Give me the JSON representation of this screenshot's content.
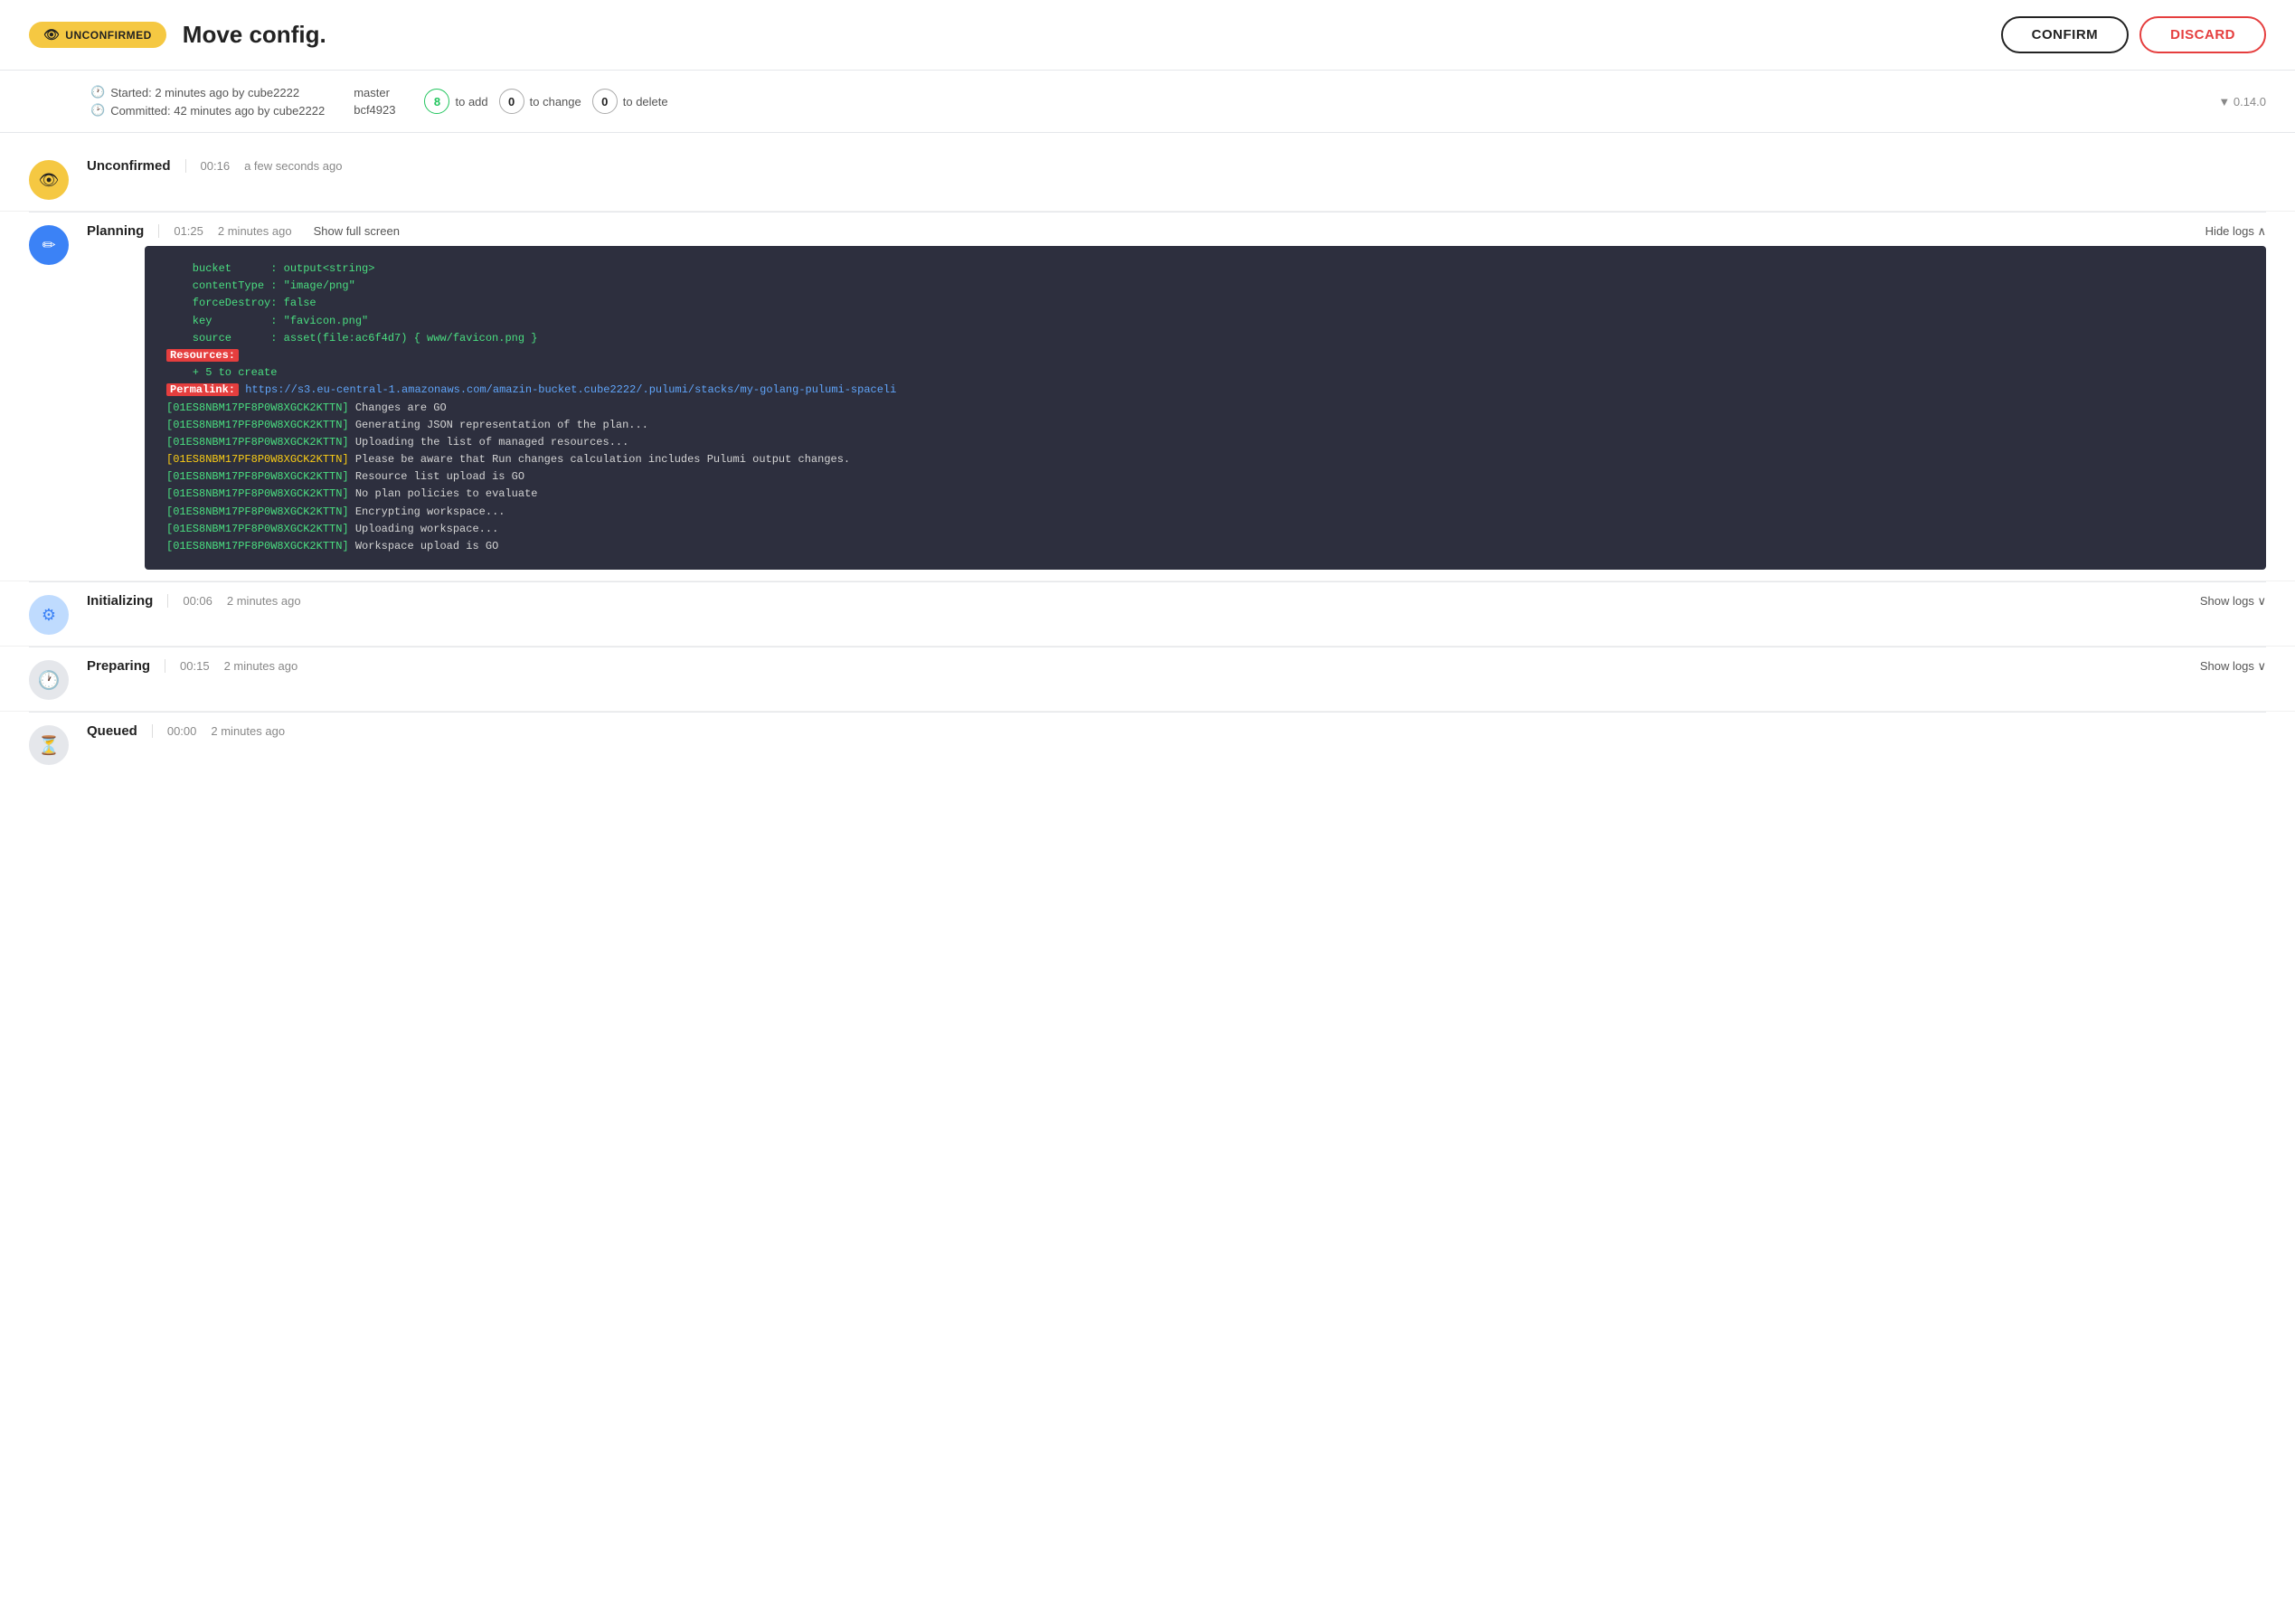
{
  "header": {
    "badge_label": "UNCONFIRMED",
    "title": "Move config.",
    "confirm_label": "CONFIRM",
    "discard_label": "DISCARD"
  },
  "meta": {
    "started": "Started: 2 minutes ago by cube2222",
    "committed": "Committed: 42 minutes ago by cube2222",
    "branch": "master",
    "commit": "bcf4923",
    "add_count": "8",
    "add_label": "to add",
    "change_count": "0",
    "change_label": "to change",
    "delete_count": "0",
    "delete_label": "to delete",
    "version": "▼ 0.14.0"
  },
  "steps": [
    {
      "icon_type": "yellow",
      "icon": "👁",
      "name": "Unconfirmed",
      "duration": "00:16",
      "time": "a few seconds ago",
      "show_logs_label": null
    },
    {
      "icon_type": "blue",
      "icon": "✏",
      "name": "Planning",
      "duration": "01:25",
      "time": "2 minutes ago",
      "show_full_screen": "Show full screen",
      "show_logs_label": "Hide logs ∧",
      "has_logs": true
    },
    {
      "icon_type": "blue-light",
      "icon": "⚙",
      "name": "Initializing",
      "duration": "00:06",
      "time": "2 minutes ago",
      "show_logs_label": "Show logs ∨"
    },
    {
      "icon_type": "gray",
      "icon": "🕐",
      "name": "Preparing",
      "duration": "00:15",
      "time": "2 minutes ago",
      "show_logs_label": "Show logs ∨"
    },
    {
      "icon_type": "gray",
      "icon": "⏳",
      "name": "Queued",
      "duration": "00:00",
      "time": "2 minutes ago",
      "show_logs_label": null
    }
  ],
  "logs": {
    "lines": [
      {
        "type": "green",
        "text": "    bucket      : output<string>"
      },
      {
        "type": "green",
        "text": "    contentType : \"image/png\""
      },
      {
        "type": "green",
        "text": "    forceDestroy: false"
      },
      {
        "type": "green",
        "text": "    key         : \"favicon.png\""
      },
      {
        "type": "green",
        "text": "    source      : asset(file:ac6f4d7) { www/favicon.png }"
      },
      {
        "type": "red-bg-label",
        "label": "Resources:",
        "text": ""
      },
      {
        "type": "green",
        "text": "    + 5 to create"
      },
      {
        "type": "permalink",
        "label": "Permalink:",
        "url": "https://s3.eu-central-1.amazonaws.com/amazin-bucket.cube2222/.pulumi/stacks/my-golang-pulumi-spaceli"
      },
      {
        "type": "cyan",
        "id": "[01ES8NBM17PF8P0W8XGCK2KTTN]",
        "text": " Changes are GO"
      },
      {
        "type": "cyan",
        "id": "[01ES8NBM17PF8P0W8XGCK2KTTN]",
        "text": " Generating JSON representation of the plan..."
      },
      {
        "type": "cyan",
        "id": "[01ES8NBM17PF8P0W8XGCK2KTTN]",
        "text": " Uploading the list of managed resources..."
      },
      {
        "type": "yellow-id",
        "id": "[01ES8NBM17PF8P0W8XGCK2KTTN]",
        "text": " Please be aware that Run changes calculation includes Pulumi output changes."
      },
      {
        "type": "cyan",
        "id": "[01ES8NBM17PF8P0W8XGCK2KTTN]",
        "text": " Resource list upload is GO"
      },
      {
        "type": "cyan",
        "id": "[01ES8NBM17PF8P0W8XGCK2KTTN]",
        "text": " No plan policies to evaluate"
      },
      {
        "type": "cyan",
        "id": "[01ES8NBM17PF8P0W8XGCK2KTTN]",
        "text": " Encrypting workspace..."
      },
      {
        "type": "cyan",
        "id": "[01ES8NBM17PF8P0W8XGCK2KTTN]",
        "text": " Uploading workspace..."
      },
      {
        "type": "cyan",
        "id": "[01ES8NBM17PF8P0W8XGCK2KTTN]",
        "text": " Workspace upload is GO"
      }
    ]
  }
}
